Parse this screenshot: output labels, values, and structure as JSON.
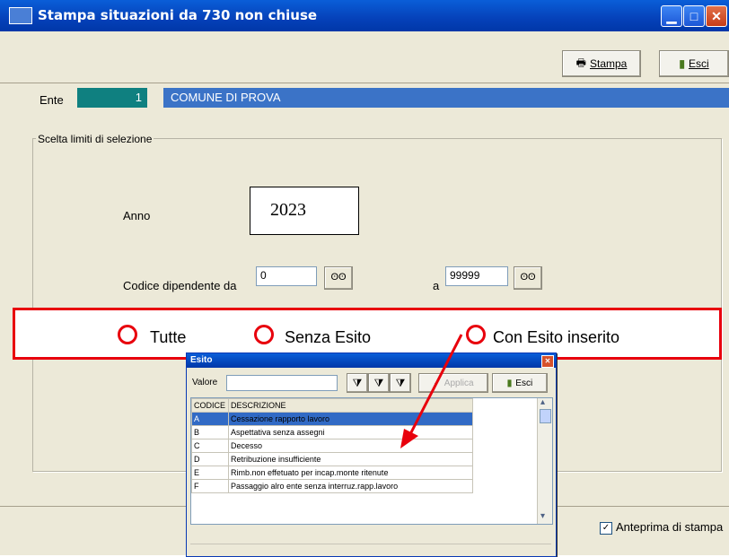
{
  "window": {
    "title": "Stampa situazioni da 730 non chiuse",
    "toolbar": {
      "print_label": "Stampa",
      "exit_label": "Esci"
    }
  },
  "ente": {
    "label": "Ente",
    "code": "1",
    "name": "COMUNE DI PROVA"
  },
  "selection": {
    "group_title": "Scelta limiti di selezione",
    "year_label": "Anno",
    "year_value": "2023",
    "employee_from_label": "Codice dipendente da",
    "employee_from_value": "0",
    "employee_to_label": "a",
    "employee_to_value": "99999"
  },
  "options": [
    "Tutte",
    "Senza Esito",
    "Con Esito inserito"
  ],
  "preview_label": "Anteprima di stampa",
  "preview_checked": true,
  "esito_dialog": {
    "title": "Esito",
    "valore_label": "Valore",
    "valore_value": "",
    "apply_label": "Applica",
    "exit_label": "Esci",
    "columns": [
      "CODICE",
      "DESCRIZIONE"
    ],
    "rows": [
      [
        "A",
        "Cessazione rapporto lavoro"
      ],
      [
        "B",
        "Aspettativa senza assegni"
      ],
      [
        "C",
        "Decesso"
      ],
      [
        "D",
        "Retribuzione insufficiente"
      ],
      [
        "E",
        "Rimb.non effetuato per incap.monte ritenute"
      ],
      [
        "F",
        "Passaggio alro ente senza interruz.rapp.lavoro"
      ]
    ]
  },
  "colors": {
    "annotation_red": "#e8000c",
    "titlebar_blue": "#0a5ed8",
    "ente_teal": "#0f8080",
    "ente_blue": "#3b73c7"
  }
}
